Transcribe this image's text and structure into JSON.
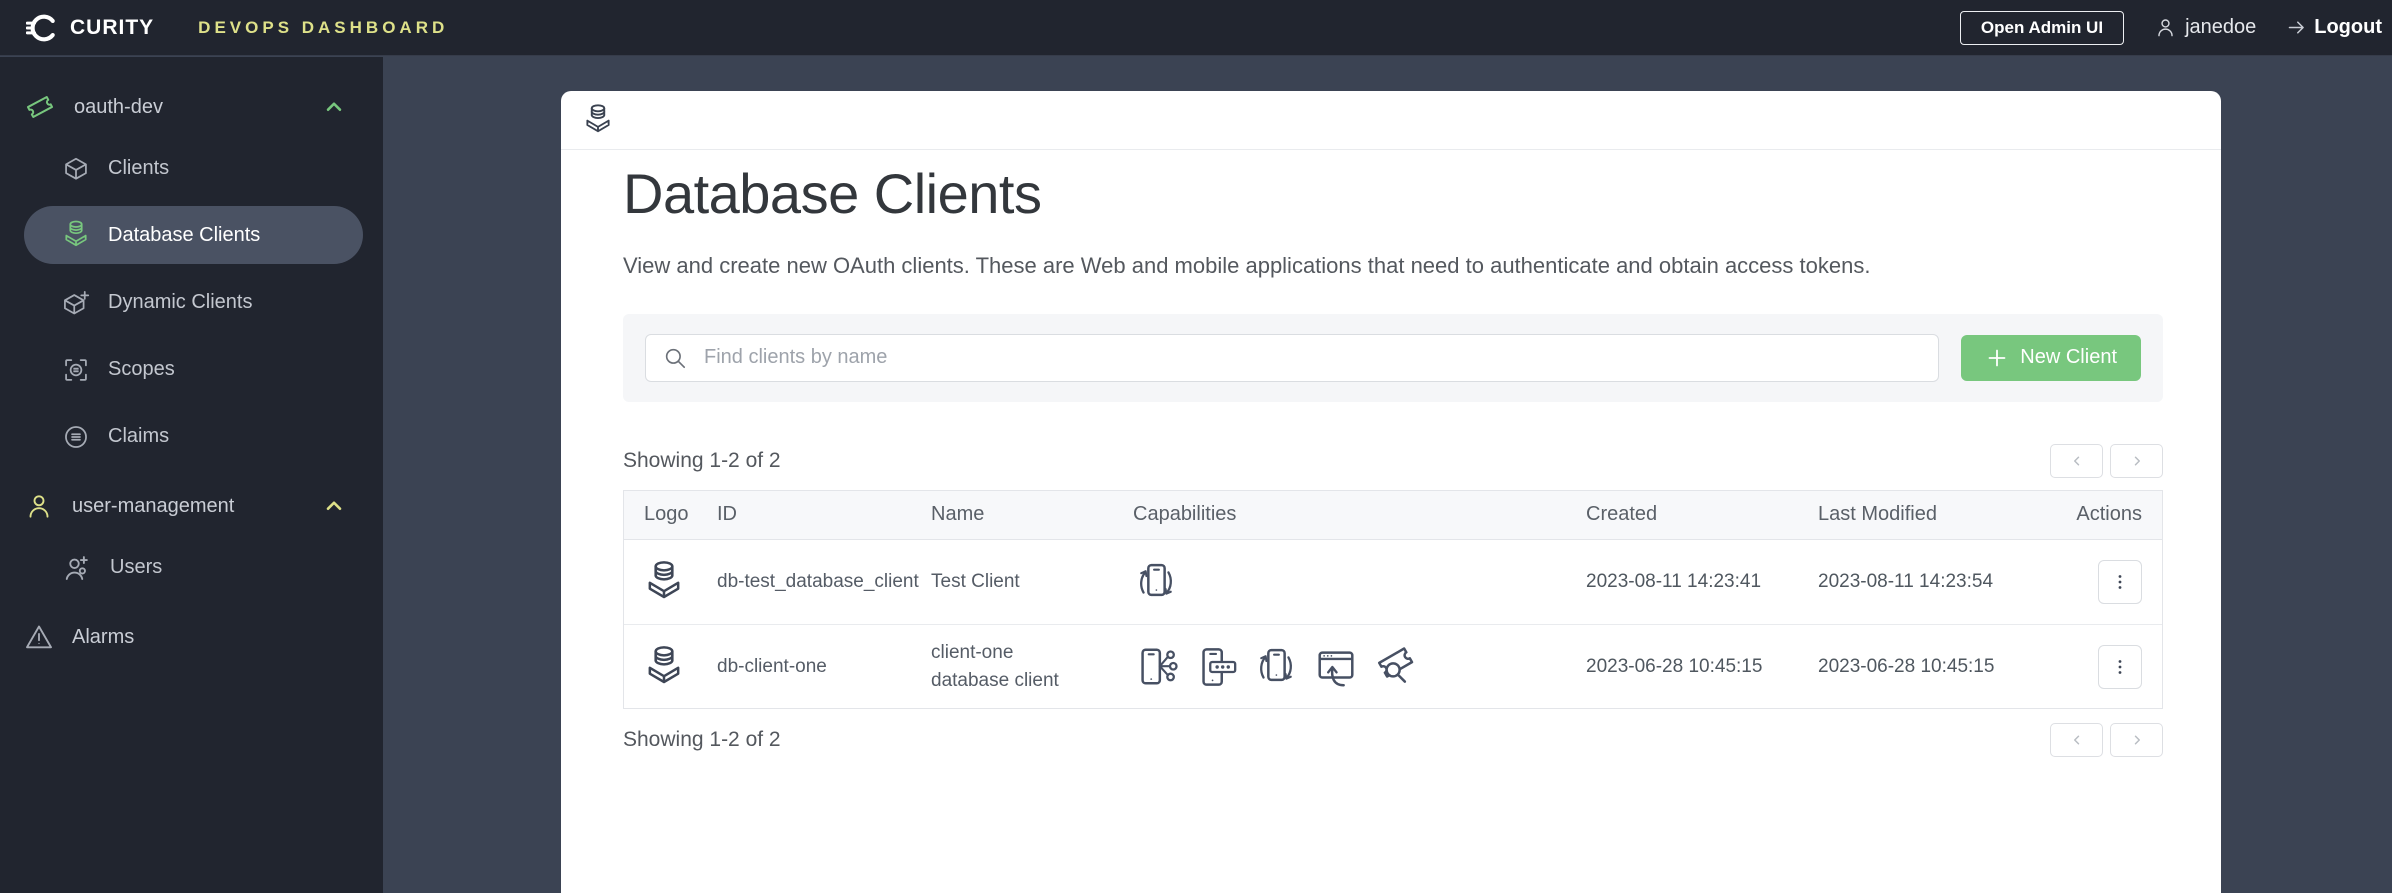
{
  "topbar": {
    "brand": "CURITY",
    "app_title": "DEVOPS DASHBOARD",
    "open_admin_ui_label": "Open Admin UI",
    "username": "janedoe",
    "logout_label": "Logout"
  },
  "sidebar": {
    "sections": [
      {
        "label": "oauth-dev",
        "items": [
          {
            "label": "Clients"
          },
          {
            "label": "Database Clients"
          },
          {
            "label": "Dynamic Clients"
          },
          {
            "label": "Scopes"
          },
          {
            "label": "Claims"
          }
        ]
      },
      {
        "label": "user-management",
        "items": [
          {
            "label": "Users"
          }
        ]
      }
    ],
    "alarms_label": "Alarms",
    "selected_item": "Database Clients"
  },
  "page": {
    "title": "Database Clients",
    "description": "View and create new OAuth clients. These are Web and mobile applications that need to authenticate and obtain access tokens.",
    "search_placeholder": "Find clients by name",
    "new_client_label": "New Client",
    "showing_text_top": "Showing 1-2 of 2",
    "showing_text_bottom": "Showing 1-2 of 2",
    "table": {
      "columns": [
        "Logo",
        "ID",
        "Name",
        "Capabilities",
        "Created",
        "Last Modified",
        "Actions"
      ],
      "rows": [
        {
          "id": "db-test_database_client",
          "name": "Test Client",
          "capabilities": [
            "phone-refresh"
          ],
          "created": "2023-08-11 14:23:41",
          "last_modified": "2023-08-11 14:23:54"
        },
        {
          "id": "db-client-one",
          "name": "client-one database client",
          "capabilities": [
            "phone-network",
            "phone-password",
            "phone-refresh",
            "browser-redirect",
            "ticket-search"
          ],
          "created": "2023-06-28 10:45:15",
          "last_modified": "2023-06-28 10:45:15"
        }
      ]
    }
  },
  "colors": {
    "accent_green": "#78C77E",
    "accent_yellow": "#DEE189",
    "topbar_bg": "#21252F",
    "sidebar_bg": "#21252F",
    "content_bg": "#3B4353",
    "selected_pill_bg": "#4A5263"
  }
}
